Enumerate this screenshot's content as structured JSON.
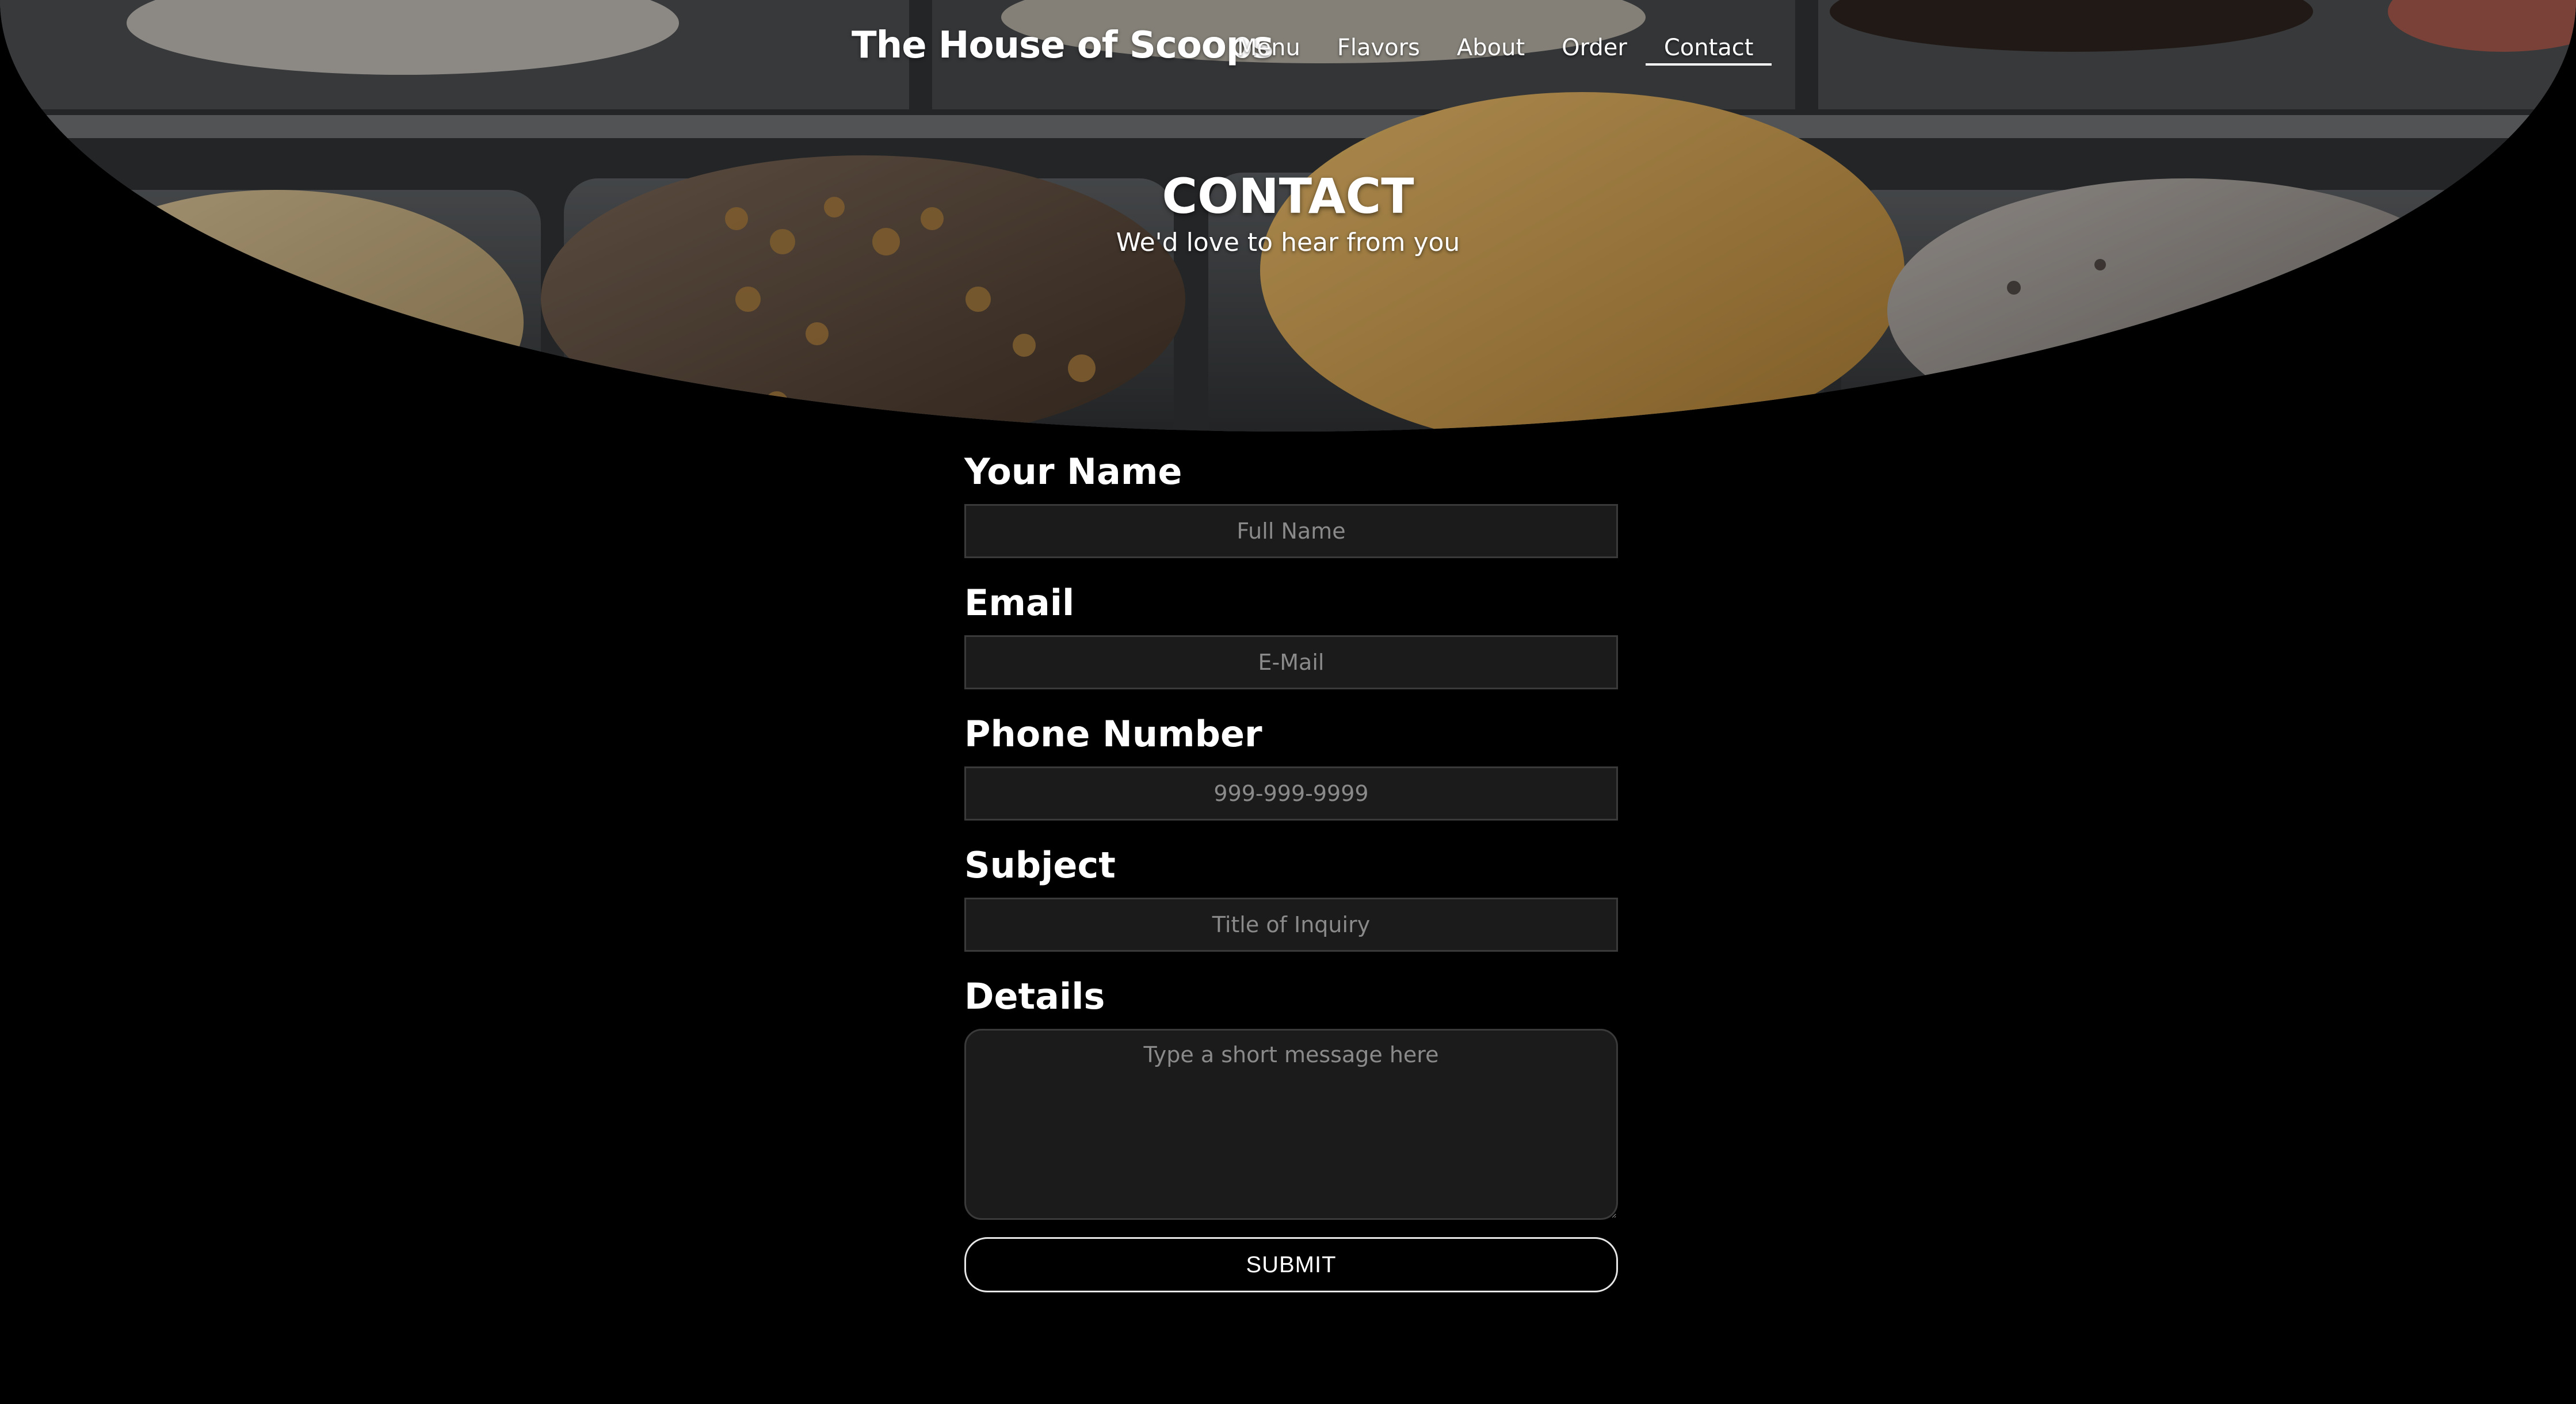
{
  "header": {
    "brand": "The House of Scoops",
    "nav": [
      {
        "label": "Menu"
      },
      {
        "label": "Flavors"
      },
      {
        "label": "About"
      },
      {
        "label": "Order"
      },
      {
        "label": "Contact",
        "active": true
      }
    ]
  },
  "hero": {
    "title": "CONTACT",
    "subtitle": "We'd love to hear from you"
  },
  "form": {
    "name": {
      "label": "Your Name",
      "placeholder": "Full Name",
      "value": ""
    },
    "email": {
      "label": "Email",
      "placeholder": "E-Mail",
      "value": ""
    },
    "phone": {
      "label": "Phone Number",
      "placeholder": "999-999-9999",
      "value": ""
    },
    "subject": {
      "label": "Subject",
      "placeholder": "Title of Inquiry",
      "value": ""
    },
    "details": {
      "label": "Details",
      "placeholder": "Type a short message here",
      "value": ""
    },
    "submit_label": "SUBMIT"
  },
  "colors": {
    "background": "#000000",
    "text": "#ffffff",
    "input_background": "#1b1b1b",
    "input_border": "#3a3a3a",
    "placeholder": "#8a8a8a"
  }
}
